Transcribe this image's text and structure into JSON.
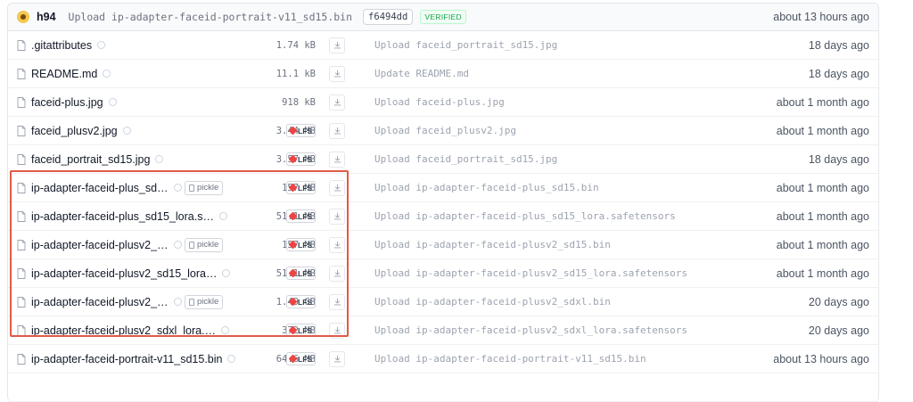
{
  "commit": {
    "author": "h94",
    "message": "Upload ip-adapter-faceid-portrait-v11_sd15.bin",
    "sha": "f6494dd",
    "verified": "VERIFIED",
    "time": "about 13 hours ago"
  },
  "files": [
    {
      "name": "gitattributes",
      "display": ".gitattributes",
      "size": "1.74 kB",
      "lfs": false,
      "pickle": false,
      "message": "Upload faceid_portrait_sd15.jpg",
      "time": "18 days ago"
    },
    {
      "name": "readme",
      "display": "README.md",
      "size": "11.1 kB",
      "lfs": false,
      "pickle": false,
      "message": "Update README.md",
      "time": "18 days ago"
    },
    {
      "name": "faceid-plus-jpg",
      "display": "faceid-plus.jpg",
      "size": "918 kB",
      "lfs": false,
      "pickle": false,
      "message": "Upload faceid-plus.jpg",
      "time": "about 1 month ago"
    },
    {
      "name": "faceid-plusv2-jpg",
      "display": "faceid_plusv2.jpg",
      "size": "3.44 MB",
      "lfs": true,
      "pickle": false,
      "message": "Upload faceid_plusv2.jpg",
      "time": "about 1 month ago"
    },
    {
      "name": "faceid-portrait-jpg",
      "display": "faceid_portrait_sd15.jpg",
      "size": "3.57 MB",
      "lfs": true,
      "pickle": false,
      "message": "Upload faceid_portrait_sd15.jpg",
      "time": "18 days ago"
    },
    {
      "name": "faceid-plus-bin",
      "display": "ip-adapter-faceid-plus_sd…",
      "size": "157 MB",
      "lfs": true,
      "pickle": true,
      "message": "Upload ip-adapter-faceid-plus_sd15.bin",
      "time": "about 1 month ago"
    },
    {
      "name": "faceid-plus-lora",
      "display": "ip-adapter-faceid-plus_sd15_lora.s…",
      "size": "51.1 MB",
      "lfs": true,
      "pickle": false,
      "message": "Upload ip-adapter-faceid-plus_sd15_lora.safetensors",
      "time": "about 1 month ago"
    },
    {
      "name": "faceid-plusv2-bin",
      "display": "ip-adapter-faceid-plusv2_…",
      "size": "157 MB",
      "lfs": true,
      "pickle": true,
      "message": "Upload ip-adapter-faceid-plusv2_sd15.bin",
      "time": "about 1 month ago"
    },
    {
      "name": "faceid-plusv2-lora",
      "display": "ip-adapter-faceid-plusv2_sd15_lora…",
      "size": "51.1 MB",
      "lfs": true,
      "pickle": false,
      "message": "Upload ip-adapter-faceid-plusv2_sd15_lora.safetensors",
      "time": "about 1 month ago"
    },
    {
      "name": "faceid-plusv2-sdxl-bin",
      "display": "ip-adapter-faceid-plusv2_…",
      "size": "1.49 GB",
      "lfs": true,
      "pickle": true,
      "message": "Upload ip-adapter-faceid-plusv2_sdxl.bin",
      "time": "20 days ago"
    },
    {
      "name": "faceid-plusv2-sdxl-lora",
      "display": "ip-adapter-faceid-plusv2_sdxl_lora.…",
      "size": "372 MB",
      "lfs": true,
      "pickle": false,
      "message": "Upload ip-adapter-faceid-plusv2_sdxl_lora.safetensors",
      "time": "20 days ago"
    },
    {
      "name": "faceid-portrait-v11-bin",
      "display": "ip-adapter-faceid-portrait-v11_sd15.bin",
      "size": "64.6 MB",
      "lfs": true,
      "pickle": false,
      "message": "Upload ip-adapter-faceid-portrait-v11_sd15.bin",
      "time": "about 13 hours ago"
    }
  ],
  "labels": {
    "lfs": "LFS",
    "pickle": "pickle"
  },
  "colors": {
    "highlight": "#e05a47",
    "lfs_gem": "#ef4444",
    "verified": "#16a34a"
  }
}
